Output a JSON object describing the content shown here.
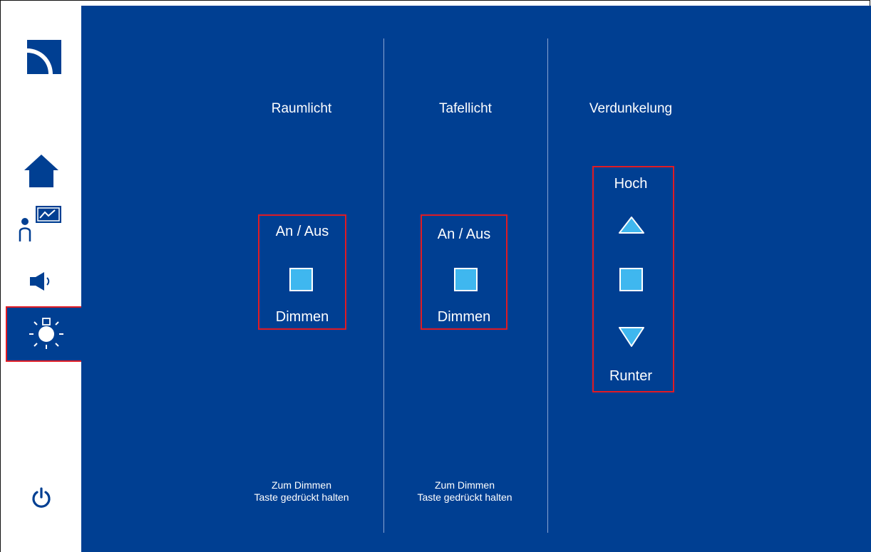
{
  "sidebar": {
    "items": [
      {
        "name": "home",
        "icon": "home-icon"
      },
      {
        "name": "presentation",
        "icon": "presenter-icon"
      },
      {
        "name": "audio",
        "icon": "speaker-icon"
      },
      {
        "name": "light",
        "icon": "light-bulb-icon",
        "active": true
      }
    ],
    "logo_icon": "brand-logo-icon",
    "power_icon": "power-icon"
  },
  "columns": {
    "raumlicht": {
      "title": "Raumlicht",
      "top_label": "An / Aus",
      "bottom_label": "Dimmen",
      "hint_line1": "Zum Dimmen",
      "hint_line2": "Taste gedrückt halten"
    },
    "tafellicht": {
      "title": "Tafellicht",
      "top_label": "An / Aus",
      "bottom_label": "Dimmen",
      "hint_line1": "Zum Dimmen",
      "hint_line2": "Taste gedrückt halten"
    },
    "verdunkelung": {
      "title": "Verdunkelung",
      "up_label": "Hoch",
      "down_label": "Runter"
    }
  },
  "colors": {
    "main_bg": "#003f92",
    "button_fill": "#3fb7ef",
    "highlight_border": "#e01b24",
    "sidebar_icon": "#003f92"
  }
}
